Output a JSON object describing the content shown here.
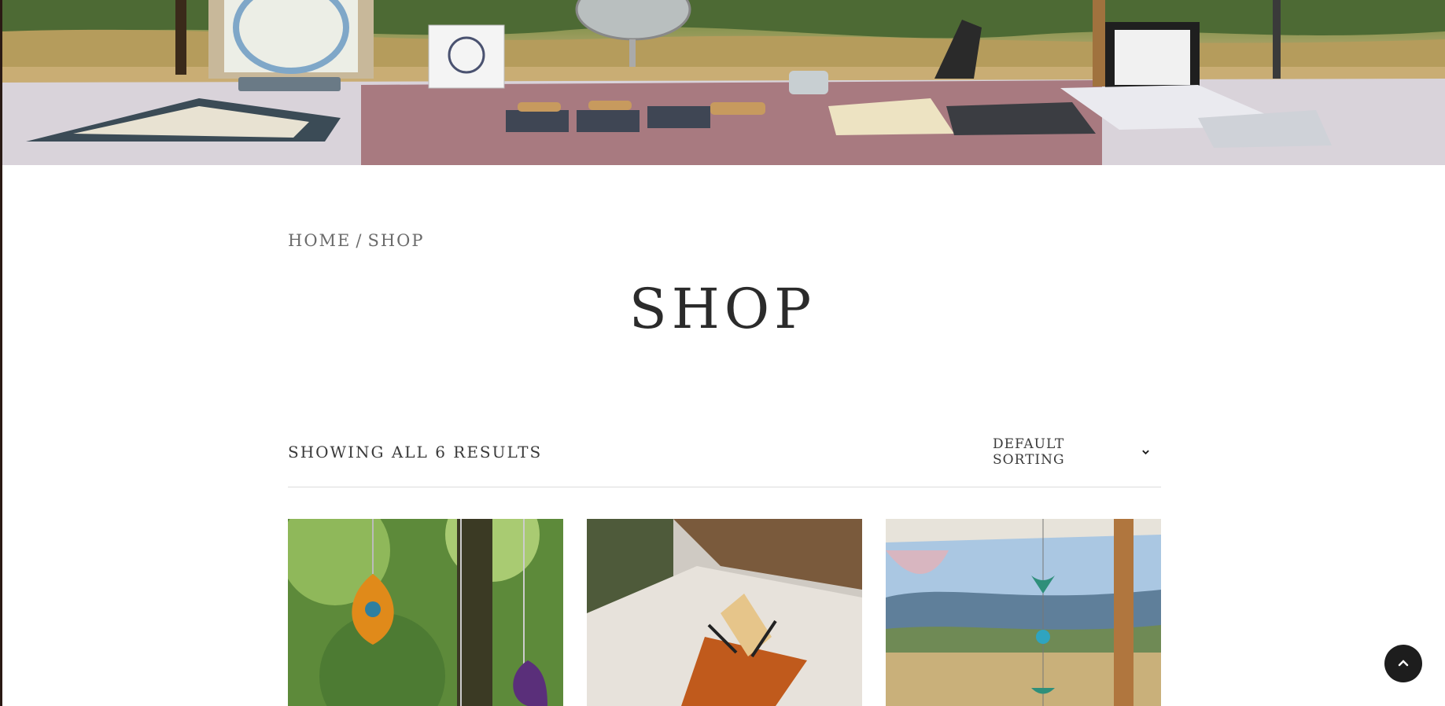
{
  "breadcrumb": {
    "home": "HOME",
    "separator": "/",
    "current": "SHOP"
  },
  "page": {
    "title": "SHOP"
  },
  "toolbar": {
    "result_count": "SHOWING ALL 6 RESULTS",
    "sorting_label": "DEFAULT SORTING",
    "sorting_icon": "chevron-down-icon"
  },
  "products": [
    {
      "image": "hanging-pendants-in-garden"
    },
    {
      "image": "palo-santo-on-glass-holder"
    },
    {
      "image": "stained-glass-mobile-landscape"
    }
  ],
  "back_to_top": {
    "icon": "chevron-up-icon",
    "color": "#1d1d1d"
  }
}
